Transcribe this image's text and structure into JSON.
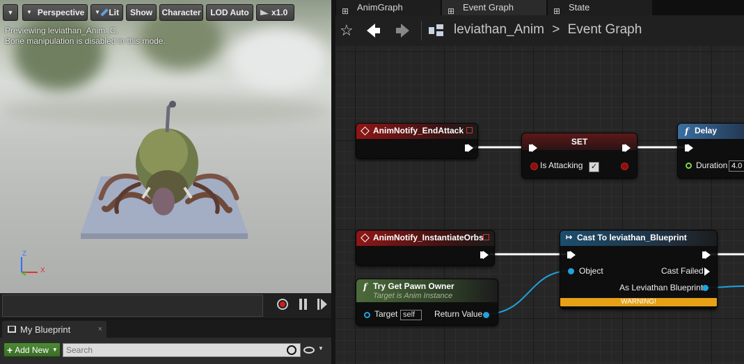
{
  "viewport": {
    "toolbar": {
      "perspective": "Perspective",
      "lit": "Lit",
      "show": "Show",
      "character": "Character",
      "lod": "LOD Auto",
      "speed": "x1.0"
    },
    "info_line1": "Previewing leviathan_Anim_C.",
    "info_line2": "Bone manipulation is disabled in this mode.",
    "axis": {
      "z": "Z",
      "y": "Y",
      "x": "X"
    }
  },
  "my_blueprint": {
    "tab_label": "My Blueprint",
    "add_new_label": "Add New",
    "search_placeholder": "Search"
  },
  "graph_tabs": [
    {
      "label": "AnimGraph"
    },
    {
      "label": "Event Graph"
    },
    {
      "label": "State"
    }
  ],
  "breadcrumb": {
    "asset": "leviathan_Anim",
    "separator": ">",
    "graph": "Event Graph"
  },
  "nodes": {
    "notify_end_attack": {
      "title": "AnimNotify_EndAttack"
    },
    "set_node": {
      "title": "SET",
      "pin_label": "Is Attacking",
      "checked": true
    },
    "delay": {
      "title": "Delay",
      "duration_label": "Duration",
      "duration_value": "4.0"
    },
    "notify_instantiate": {
      "title": "AnimNotify_InstantiateOrbs"
    },
    "cast": {
      "title": "Cast To leviathan_Blueprint",
      "object_label": "Object",
      "cast_failed_label": "Cast Failed",
      "as_label": "As Leviathan Blueprint",
      "warning": "WARNING!"
    },
    "try_get_pawn": {
      "title": "Try Get Pawn Owner",
      "subtitle": "Target is Anim Instance",
      "target_label": "Target",
      "target_value": "self",
      "return_label": "Return Value"
    }
  },
  "colors": {
    "event_header": "#8e1616",
    "function_header": "#4c6b3b",
    "cast_header": "#1c4e6e",
    "object_pin": "#1fa3e0",
    "bool_pin": "#8c0f0f",
    "float_pin": "#7bd94a",
    "warning_bar": "#e6a117"
  }
}
